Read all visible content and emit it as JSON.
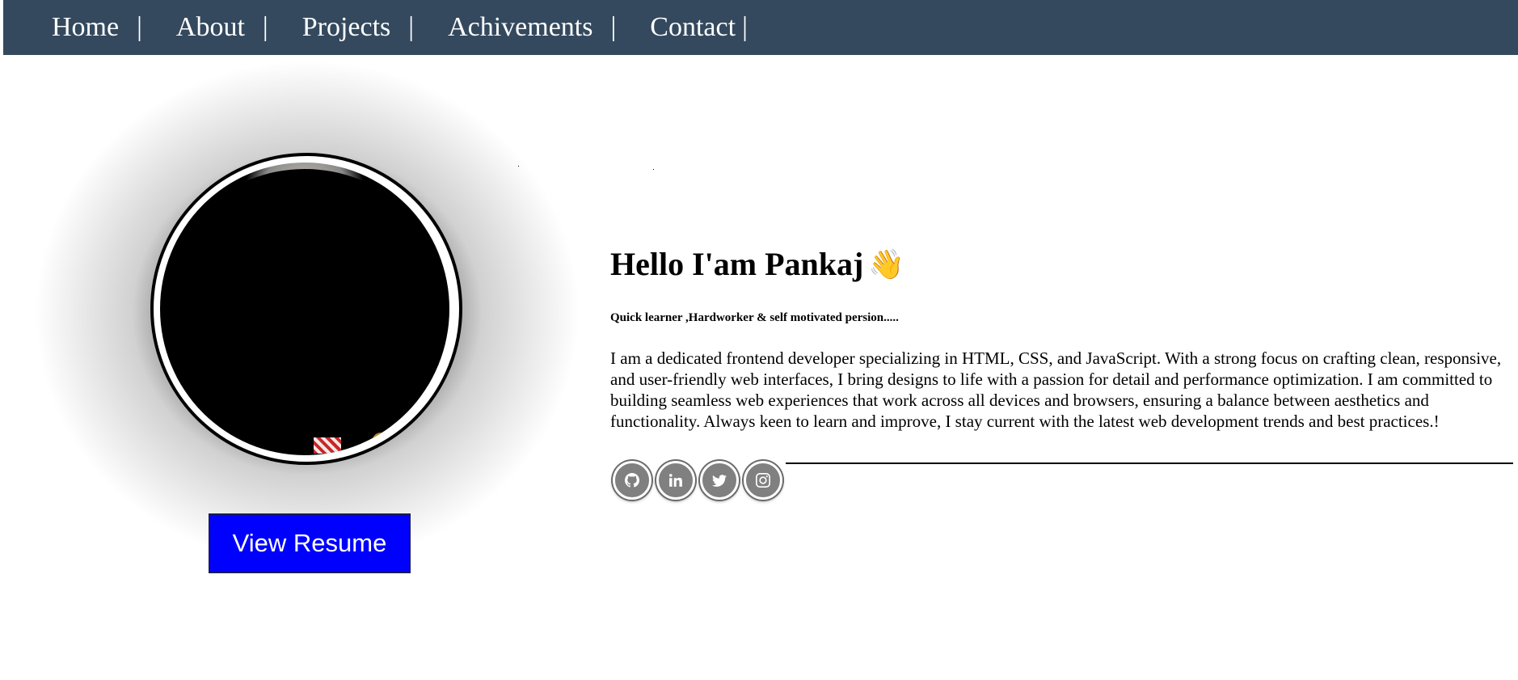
{
  "nav": {
    "items": [
      {
        "label": "Home",
        "sep": "|"
      },
      {
        "label": "About",
        "sep": "|"
      },
      {
        "label": "Projects",
        "sep": "|"
      },
      {
        "label": "Achivements",
        "sep": "|"
      },
      {
        "label": "Contact",
        "sep": "|"
      }
    ]
  },
  "profile": {
    "resume_button": "View Resume"
  },
  "hero": {
    "title": "Hello I'am Pankaj",
    "title_emoji": "👋",
    "tagline": "Quick learner ,Hardworker & self motivated persion.....",
    "bio": "I am a dedicated frontend developer specializing in HTML, CSS, and JavaScript. With a strong focus on crafting clean, responsive, and user-friendly web interfaces, I bring designs to life with a passion for detail and performance optimization. I am committed to building seamless web experiences that work across all devices and browsers, ensuring a balance between aesthetics and functionality. Always keen to learn and improve, I stay current with the latest web development trends and best practices.!"
  },
  "socials": [
    {
      "name": "github-icon"
    },
    {
      "name": "linkedin-icon"
    },
    {
      "name": "twitter-icon"
    },
    {
      "name": "instagram-icon"
    }
  ],
  "colors": {
    "navbar": "#34495e",
    "resume_button": "#0000ff",
    "social_button": "#808080"
  }
}
